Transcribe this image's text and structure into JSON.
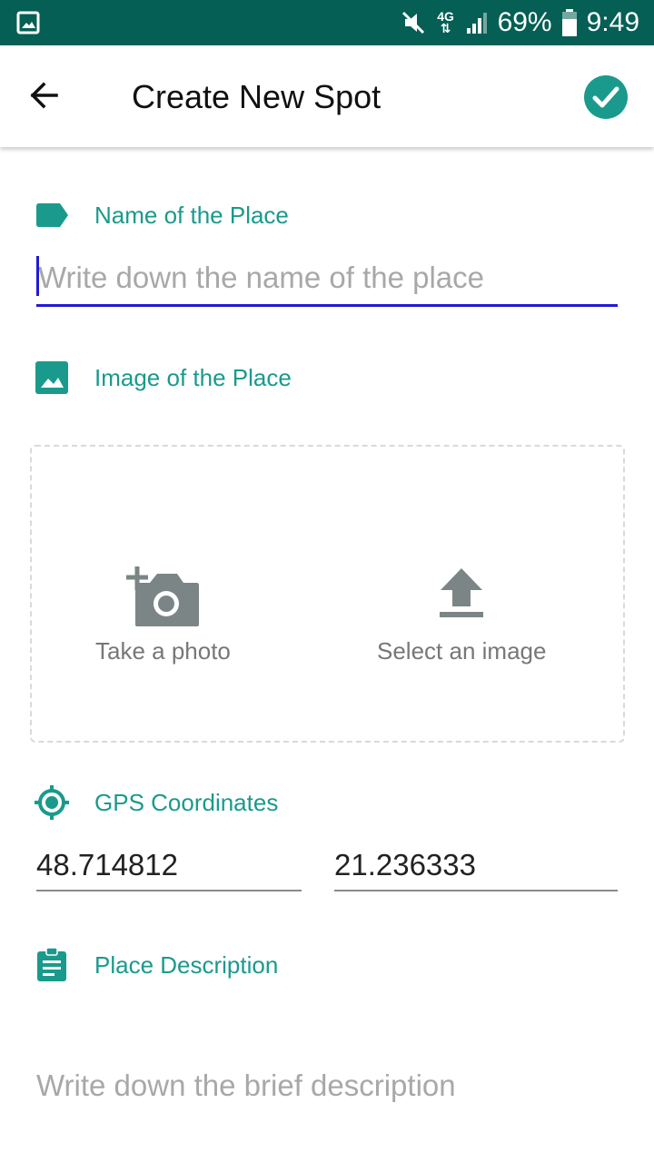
{
  "status_bar": {
    "network": "4G",
    "battery": "69%",
    "time": "9:49",
    "icons": [
      "image-icon",
      "mute-icon",
      "network-4g-icon",
      "signal-icon",
      "battery-icon"
    ]
  },
  "app_bar": {
    "title": "Create New Spot",
    "back_icon": "arrow-back-icon",
    "confirm_icon": "check-circle-icon"
  },
  "name_section": {
    "label": "Name of the Place",
    "icon": "label-icon",
    "input_value": "",
    "placeholder": "Write down the name of the place"
  },
  "image_section": {
    "label": "Image of the Place",
    "icon": "image-icon",
    "take_photo_label": "Take a photo",
    "take_photo_icon": "add-camera-icon",
    "select_image_label": "Select an image",
    "select_image_icon": "upload-icon"
  },
  "gps_section": {
    "label": "GPS Coordinates",
    "icon": "gps-target-icon",
    "latitude": "48.714812",
    "longitude": "21.236333"
  },
  "description_section": {
    "label": "Place Description",
    "icon": "clipboard-icon",
    "input_value": "",
    "placeholder": "Write down the brief description"
  },
  "colors": {
    "status_bar": "#055f54",
    "accent": "#1a9a8c",
    "input_focus": "#2319d6",
    "icon_gray": "#7b8585"
  }
}
